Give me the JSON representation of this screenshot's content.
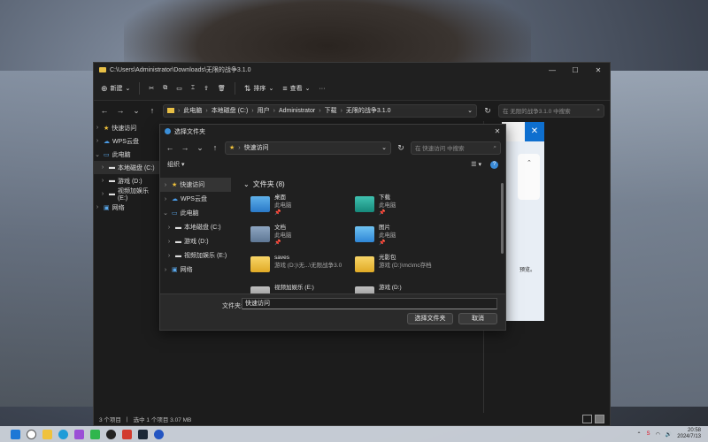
{
  "explorer": {
    "title": "C:\\Users\\Administrator\\Downloads\\无限的战争3.1.0",
    "toolbar": {
      "new_label": "新建",
      "sort_label": "排序",
      "view_label": "查看"
    },
    "breadcrumbs": [
      "此电脑",
      "本地磁盘 (C:)",
      "用户",
      "Administrator",
      "下载",
      "无限的战争3.1.0"
    ],
    "search_placeholder": "在 无限的战争3.1.0 中搜索",
    "sidebar": [
      {
        "label": "快速访问",
        "icon": "star-icon"
      },
      {
        "label": "WPS云盘",
        "icon": "cloud-icon"
      },
      {
        "label": "此电脑",
        "icon": "pc-icon"
      },
      {
        "label": "本地磁盘 (C:)",
        "icon": "drive-icon"
      },
      {
        "label": "游戏 (D:)",
        "icon": "drive-icon"
      },
      {
        "label": "视频加娱乐 (E:)",
        "icon": "drive-icon"
      },
      {
        "label": "网络",
        "icon": "network-icon"
      }
    ],
    "status": {
      "items": "3 个项目",
      "selected": "选中 1 个项目 3.07 MB"
    }
  },
  "background_dialog": {
    "hint_text": "预览。"
  },
  "picker": {
    "title": "选择文件夹",
    "address": "快速访问",
    "search_placeholder": "在 快速访问 中搜索",
    "organize_label": "组织",
    "sidebar": [
      {
        "label": "快速访问",
        "icon": "star-icon"
      },
      {
        "label": "WPS云盘",
        "icon": "cloud-icon"
      },
      {
        "label": "此电脑",
        "icon": "pc-icon"
      },
      {
        "label": "本地磁盘 (C:)",
        "icon": "drive-icon"
      },
      {
        "label": "游戏 (D:)",
        "icon": "drive-icon"
      },
      {
        "label": "视频加娱乐 (E:)",
        "icon": "drive-icon"
      },
      {
        "label": "网络",
        "icon": "network-icon"
      }
    ],
    "group_header": "文件夹 (8)",
    "folders": [
      {
        "name": "桌面",
        "sub": "此电脑",
        "icon": "desktop-folder-icon"
      },
      {
        "name": "下载",
        "sub": "此电脑",
        "icon": "downloads-folder-icon"
      },
      {
        "name": "文档",
        "sub": "此电脑",
        "icon": "documents-folder-icon"
      },
      {
        "name": "图片",
        "sub": "此电脑",
        "icon": "pictures-folder-icon"
      },
      {
        "name": "saves",
        "sub": "游戏 (D:)\\无...\\无限战争3.0",
        "icon": "folder-icon"
      },
      {
        "name": "光影包",
        "sub": "游戏 (D:)\\mc\\mc存档",
        "icon": "folder-icon"
      },
      {
        "name": "视频加娱乐 (E:)",
        "sub": "",
        "icon": "drive-icon"
      },
      {
        "name": "游戏 (D:)",
        "sub": "",
        "icon": "drive-icon"
      }
    ],
    "filename_label": "文件夹:",
    "filename_value": "快速访问",
    "select_button": "选择文件夹",
    "cancel_button": "取消"
  },
  "taskbar": {
    "time": "20:58",
    "date": "2024/7/13"
  }
}
